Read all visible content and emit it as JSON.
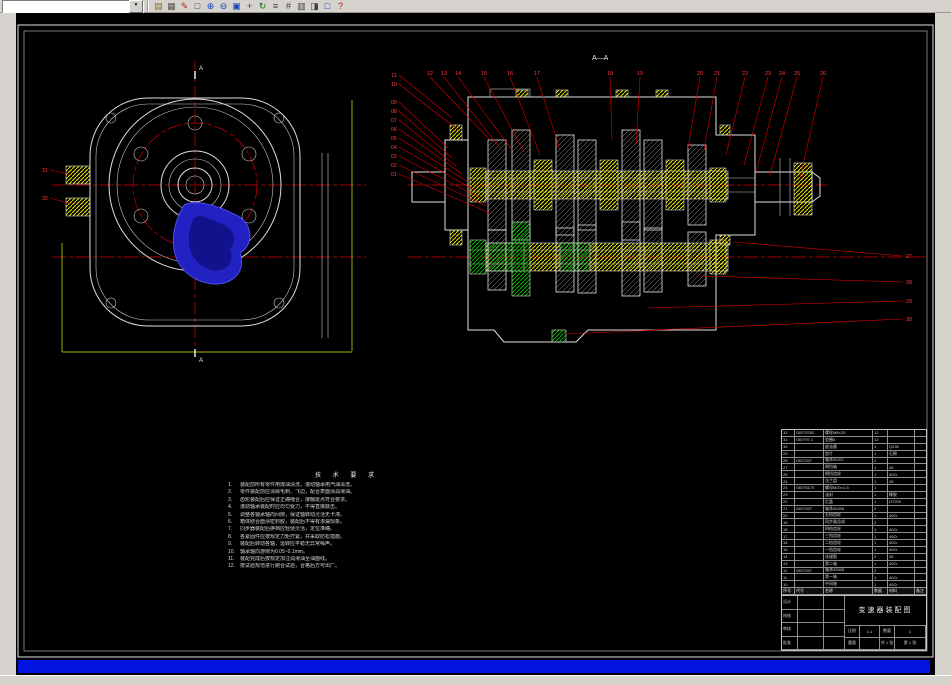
{
  "colors": {
    "canvas_bg": "#000000",
    "line_white": "#dfdfdf",
    "centerline_red": "#d40000",
    "hatch_yellow": "#e8e800",
    "hatch_green": "#00b400",
    "cavity_blue": "#2222c4",
    "highlight_bar_blue": "#0013e0",
    "chrome_gray": "#d6d3ce"
  },
  "toolbar": {
    "combo_value": "",
    "dropdown_glyph": "▼",
    "icons": [
      {
        "name": "open-icon",
        "glyph": "▤",
        "color": "#8a6d1a"
      },
      {
        "name": "print-icon",
        "glyph": "▦",
        "color": "#555555"
      },
      {
        "name": "pencil-icon",
        "glyph": "✎",
        "color": "#b02020"
      },
      {
        "name": "select-icon",
        "glyph": "□",
        "color": "#303030"
      },
      {
        "name": "zoom-in-icon",
        "glyph": "⊕",
        "color": "#1040c0"
      },
      {
        "name": "zoom-out-icon",
        "glyph": "⊖",
        "color": "#1040c0"
      },
      {
        "name": "zoom-window-icon",
        "glyph": "▣",
        "color": "#1040c0"
      },
      {
        "name": "pan-icon",
        "glyph": "+",
        "color": "#1040c0"
      },
      {
        "name": "rotate-icon",
        "glyph": "↻",
        "color": "#107010"
      },
      {
        "name": "layers-icon",
        "glyph": "≡",
        "color": "#404040"
      },
      {
        "name": "measure-icon",
        "glyph": "#",
        "color": "#404040"
      },
      {
        "name": "views-icon",
        "glyph": "▥",
        "color": "#404040"
      },
      {
        "name": "shade-icon",
        "glyph": "◨",
        "color": "#404040"
      },
      {
        "name": "fullscreen-icon",
        "glyph": "□",
        "color": "#1040c0"
      },
      {
        "name": "help-icon",
        "glyph": "?",
        "color": "#b02020"
      }
    ]
  },
  "drawing": {
    "section_label": "A—A",
    "section_mark_top": "A",
    "section_mark_bottom": "A",
    "callouts": {
      "left_top": [
        "11",
        "10"
      ],
      "left": [
        "09",
        "08",
        "07",
        "06",
        "05",
        "04",
        "03",
        "02",
        "01"
      ],
      "top": [
        "12",
        "13",
        "14",
        "15",
        "16",
        "17",
        "18",
        "19",
        "20",
        "21",
        "22",
        "23",
        "24",
        "25",
        "26"
      ],
      "right": [
        "27",
        "28",
        "29",
        "30"
      ],
      "front": [
        "31",
        "32"
      ]
    },
    "notes": {
      "title": "技 术 要 求",
      "items": [
        "装配前所有零件用煤油清洗，滚动轴承用汽油清洗。",
        "零件装配前应清除毛刺、飞边，配合表面涂润滑油。",
        "齿轮装配后应保证正确啮合，接触斑点符合要求。",
        "滚动轴承装配时应均匀受力，不得直接敲击。",
        "调整各轴承轴向间隙，保证轴转动灵活无卡滞。",
        "箱体结合面涂密封胶，装配后不得有渗漏现象。",
        "同步器装配后换档应轻便灵活，定位准确。",
        "各紧固件应按规定力矩拧紧，并采取防松措施。",
        "装配后转动各轴，运转应平稳无异常噪声。",
        "轴承轴向游隙为0.05~0.1mm。",
        "装配完成后按规定加注润滑油至油面线。",
        "按试验规范进行跑合试验，合格后方可出厂。"
      ]
    }
  },
  "title_block": {
    "header": [
      "序号",
      "代号",
      "名称",
      "数量",
      "材料",
      "备注"
    ],
    "parts": [
      [
        "32",
        "GB/T5782",
        "螺栓M8×25",
        "12",
        "",
        ""
      ],
      [
        "31",
        "GB/T97.1",
        "垫圈8",
        "12",
        "",
        ""
      ],
      [
        "30",
        "",
        "放油塞",
        "1",
        "Q235",
        ""
      ],
      [
        "29",
        "",
        "垫片",
        "1",
        "石棉",
        ""
      ],
      [
        "28",
        "GB/T297",
        "轴承30207",
        "2",
        "",
        ""
      ],
      [
        "27",
        "",
        "倒挡轴",
        "1",
        "45",
        ""
      ],
      [
        "26",
        "",
        "倒挡齿轮",
        "1",
        "40Cr",
        ""
      ],
      [
        "25",
        "",
        "法兰盘",
        "1",
        "45",
        ""
      ],
      [
        "24",
        "GB/T6170",
        "螺母M20×1.5",
        "1",
        "",
        ""
      ],
      [
        "23",
        "",
        "油封",
        "1",
        "橡胶",
        ""
      ],
      [
        "22",
        "",
        "后盖",
        "1",
        "HT200",
        ""
      ],
      [
        "21",
        "GB/T297",
        "轴承30206",
        "2",
        "",
        ""
      ],
      [
        "20",
        "",
        "五档齿轮",
        "1",
        "40Cr",
        ""
      ],
      [
        "19",
        "",
        "同步器总成",
        "2",
        "",
        ""
      ],
      [
        "18",
        "",
        "四档齿轮",
        "1",
        "40Cr",
        ""
      ],
      [
        "17",
        "",
        "三档齿轮",
        "1",
        "40Cr",
        ""
      ],
      [
        "16",
        "",
        "二档齿轮",
        "1",
        "40Cr",
        ""
      ],
      [
        "15",
        "",
        "一档齿轮",
        "1",
        "40Cr",
        ""
      ],
      [
        "14",
        "",
        "花键毂",
        "2",
        "45",
        ""
      ],
      [
        "13",
        "",
        "第二轴",
        "1",
        "40Cr",
        ""
      ],
      [
        "12",
        "GB/T297",
        "轴承30205",
        "2",
        "",
        ""
      ],
      [
        "11",
        "",
        "第一轴",
        "1",
        "40Cr",
        ""
      ],
      [
        "10",
        "",
        "中间轴",
        "1",
        "40Cr",
        ""
      ]
    ],
    "sig_rows": [
      [
        "设计",
        "",
        ""
      ],
      [
        "校核",
        "",
        ""
      ],
      [
        "审核",
        "",
        ""
      ],
      [
        "批准",
        "",
        ""
      ]
    ],
    "title": "变速器装配图",
    "meta": {
      "c1": "比例",
      "c2": "1:1",
      "c3": "数量",
      "c4": "1",
      "c5": "重量",
      "c6": "",
      "c7": "共 1 张",
      "c8": "第 1 张"
    }
  }
}
